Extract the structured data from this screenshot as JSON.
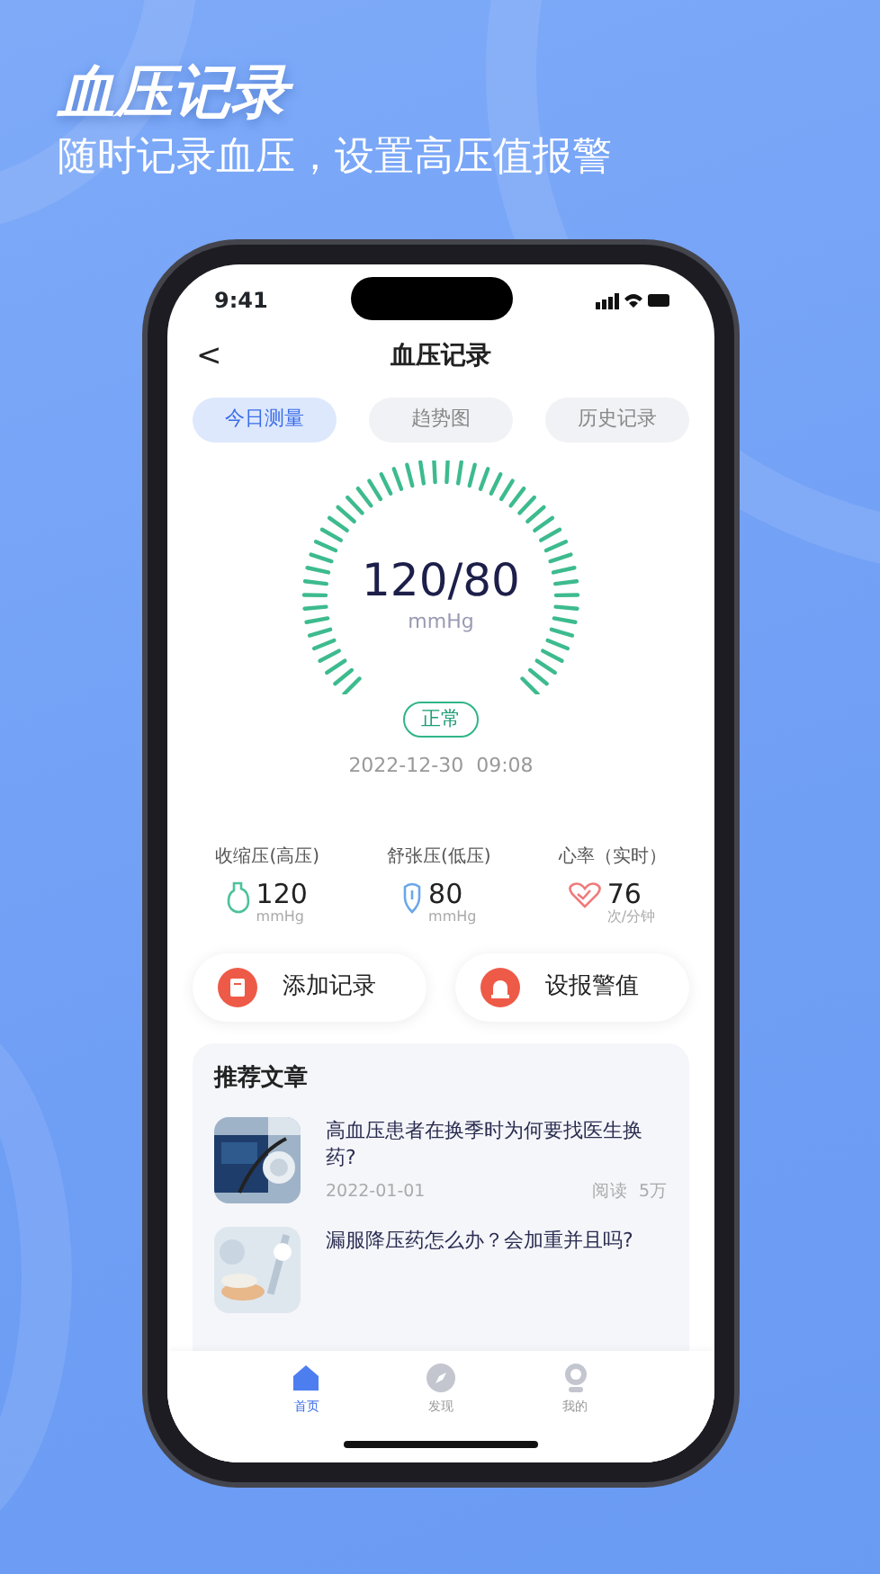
{
  "promo": {
    "title": "血压记录",
    "subtitle": "随时记录血压，设置高压值报警"
  },
  "status_bar": {
    "time": "9:41"
  },
  "nav": {
    "back": "<",
    "title": "血压记录"
  },
  "tabs": [
    {
      "label": "今日测量",
      "selected": true
    },
    {
      "label": "趋势图",
      "selected": false
    },
    {
      "label": "历史记录",
      "selected": false
    }
  ],
  "reading": {
    "value": "120/80",
    "unit": "mmHg",
    "status": "正常",
    "time": "2022-12-30  09:08"
  },
  "stats": [
    {
      "kind": "systolic",
      "label": "收缩压(高压)",
      "value": "120",
      "unit": "mmHg"
    },
    {
      "kind": "diastolic",
      "label": "舒张压(低压)",
      "value": "80",
      "unit": "mmHg"
    },
    {
      "kind": "heart",
      "label": "心率（实时）",
      "value": "76",
      "unit": "次/分钟"
    }
  ],
  "actions": [
    {
      "kind": "add",
      "label": "添加记录"
    },
    {
      "kind": "alarm",
      "label": "设报警值"
    }
  ],
  "articles": {
    "title": "推荐文章",
    "items": [
      {
        "title": "高血压患者在换季时为何要找医生换药?",
        "date": "2022-01-01",
        "reads": "阅读  5万"
      },
      {
        "title": "漏服降压药怎么办？会加重并且吗?"
      }
    ]
  },
  "bottom_nav": [
    {
      "kind": "home",
      "label": "首页",
      "selected": true
    },
    {
      "kind": "discover",
      "label": "发现",
      "selected": false
    },
    {
      "kind": "me",
      "label": "我的",
      "selected": false
    }
  ]
}
